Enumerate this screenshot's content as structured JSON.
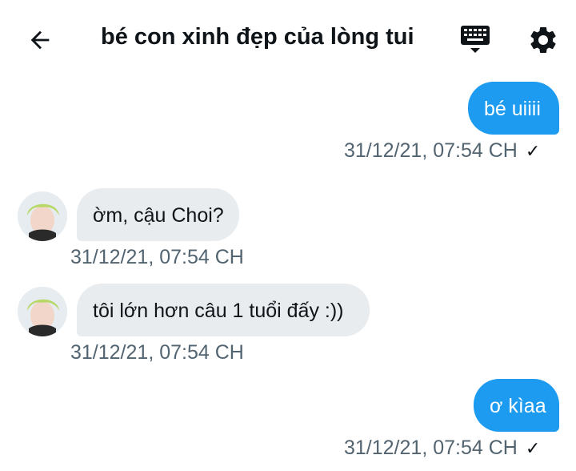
{
  "header": {
    "title": "bé con xinh đẹp của lòng tui"
  },
  "messages": [
    {
      "direction": "out",
      "text": "bé uiiii",
      "timestamp": "31/12/21, 07:54 CH",
      "status": "✓"
    },
    {
      "direction": "in",
      "text": "ờm, cậu Choi?",
      "timestamp": "31/12/21, 07:54 CH"
    },
    {
      "direction": "in",
      "text": "tôi lớn hơn câu 1 tuổi đấy :))",
      "timestamp": "31/12/21, 07:54 CH"
    },
    {
      "direction": "out",
      "text": "ơ kìaa",
      "timestamp": "31/12/21, 07:54 CH",
      "status": "✓"
    }
  ],
  "colors": {
    "accent": "#1d9bf0",
    "incoming_bubble": "#e8ecef",
    "timestamp": "#536471"
  },
  "icons": [
    "back-arrow-icon",
    "keyboard-icon",
    "gear-icon",
    "avatar"
  ]
}
